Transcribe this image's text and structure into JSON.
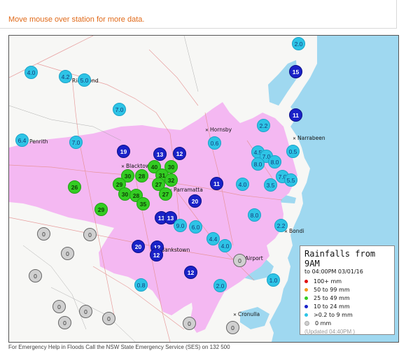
{
  "hint_text": "Move mouse over station for more data.",
  "legend": {
    "title": "Rainfalls from 9AM",
    "subtitle": "to 04:00PM 03/01/16",
    "rows": [
      {
        "label": "100+ mm",
        "color": "#e01010"
      },
      {
        "label": "50 to 99 mm",
        "color": "#f39a1c"
      },
      {
        "label": "25 to 49 mm",
        "color": "#33cc22"
      },
      {
        "label": "10 to 24 mm",
        "color": "#1a22c8"
      },
      {
        "label": ">0.2 to 9 mm",
        "color": "#2ec4e6"
      },
      {
        "label": "0 mm",
        "color": "#cfcfcf"
      }
    ],
    "updated": "(Updated 04:40PM )"
  },
  "places": [
    "Richmond",
    "Penrith",
    "Hornsby",
    "Narrabeen",
    "Blacktown",
    "Parramatta",
    "Bondi",
    "Bankstown",
    "Airport",
    "Cronulla"
  ],
  "stations": [
    {
      "v": "2.0",
      "c": "lt"
    },
    {
      "v": "4.0",
      "c": "lt"
    },
    {
      "v": "4.2",
      "c": "lt"
    },
    {
      "v": "5.0",
      "c": "lt"
    },
    {
      "v": "15",
      "c": "blue"
    },
    {
      "v": "7.0",
      "c": "lt"
    },
    {
      "v": "11",
      "c": "blue"
    },
    {
      "v": "2.2",
      "c": "lt"
    },
    {
      "v": "6.4",
      "c": "lt"
    },
    {
      "v": "7.0",
      "c": "lt"
    },
    {
      "v": "0.6",
      "c": "lt"
    },
    {
      "v": "0.5",
      "c": "lt"
    },
    {
      "v": "19",
      "c": "blue"
    },
    {
      "v": "13",
      "c": "blue"
    },
    {
      "v": "12",
      "c": "blue"
    },
    {
      "v": "4.5",
      "c": "lt"
    },
    {
      "v": "7.0",
      "c": "lt"
    },
    {
      "v": "8.0",
      "c": "lt"
    },
    {
      "v": "8.0",
      "c": "lt"
    },
    {
      "v": "40",
      "c": "green"
    },
    {
      "v": "30",
      "c": "green"
    },
    {
      "v": "31",
      "c": "green"
    },
    {
      "v": "30",
      "c": "green"
    },
    {
      "v": "28",
      "c": "green"
    },
    {
      "v": "32",
      "c": "green"
    },
    {
      "v": "7.0",
      "c": "lt"
    },
    {
      "v": "5.5",
      "c": "lt"
    },
    {
      "v": "3.5",
      "c": "lt"
    },
    {
      "v": "26",
      "c": "green"
    },
    {
      "v": "29",
      "c": "green"
    },
    {
      "v": "27",
      "c": "green"
    },
    {
      "v": "11",
      "c": "blue"
    },
    {
      "v": "4.0",
      "c": "lt"
    },
    {
      "v": "30",
      "c": "green"
    },
    {
      "v": "28",
      "c": "green"
    },
    {
      "v": "27",
      "c": "green"
    },
    {
      "v": "35",
      "c": "green"
    },
    {
      "v": "20",
      "c": "blue"
    },
    {
      "v": "29",
      "c": "green"
    },
    {
      "v": "13",
      "c": "blue"
    },
    {
      "v": "13",
      "c": "blue"
    },
    {
      "v": "8.0",
      "c": "lt"
    },
    {
      "v": "9.0",
      "c": "lt"
    },
    {
      "v": "6.0",
      "c": "lt"
    },
    {
      "v": "2.2",
      "c": "lt"
    },
    {
      "v": "0",
      "c": "grey"
    },
    {
      "v": "0",
      "c": "grey"
    },
    {
      "v": "4.4",
      "c": "lt"
    },
    {
      "v": "4.0",
      "c": "lt"
    },
    {
      "v": "20",
      "c": "blue"
    },
    {
      "v": "12",
      "c": "blue"
    },
    {
      "v": "12",
      "c": "blue"
    },
    {
      "v": "0",
      "c": "grey"
    },
    {
      "v": "0",
      "c": "grey"
    },
    {
      "v": "12",
      "c": "blue"
    },
    {
      "v": "0",
      "c": "grey"
    },
    {
      "v": "0.8",
      "c": "lt"
    },
    {
      "v": "2.0",
      "c": "lt"
    },
    {
      "v": "1.0",
      "c": "lt"
    },
    {
      "v": "0",
      "c": "grey"
    },
    {
      "v": "0",
      "c": "grey"
    },
    {
      "v": "0",
      "c": "grey"
    },
    {
      "v": "0",
      "c": "grey"
    },
    {
      "v": "0",
      "c": "grey"
    },
    {
      "v": "0",
      "c": "grey"
    }
  ],
  "footer_text": "For Emergency Help in Floods Call the NSW State Emergency Service (SES) on 132 500"
}
